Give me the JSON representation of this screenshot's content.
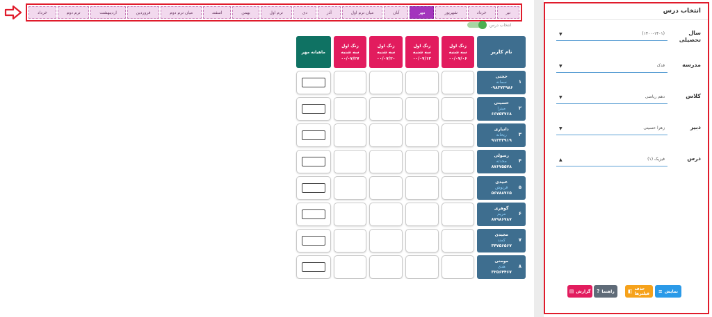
{
  "tabs": [
    {
      "label": "تیر"
    },
    {
      "label": "خرداد"
    },
    {
      "label": "شهریور"
    },
    {
      "label": "مهر",
      "active": true
    },
    {
      "label": "آبان"
    },
    {
      "label": "میان ترم اول"
    },
    {
      "label": "آذر"
    },
    {
      "label": "دی"
    },
    {
      "label": "ترم اول"
    },
    {
      "label": "بهمن"
    },
    {
      "label": "اسفند"
    },
    {
      "label": "میان ترم دوم"
    },
    {
      "label": "فروردین"
    },
    {
      "label": "اردیبهشت"
    },
    {
      "label": "ترم دوم"
    },
    {
      "label": "خرداد"
    }
  ],
  "toggle": {
    "label": "انتخاب درس",
    "on": true
  },
  "grid": {
    "header_name": "نام کاربر",
    "sessions": [
      {
        "line1": "زنگ اول",
        "line2": "سه شنبه",
        "line3": "۰۰/۰۷/۰۶"
      },
      {
        "line1": "زنگ اول",
        "line2": "سه شنبه",
        "line3": "۰۰/۰۷/۱۳"
      },
      {
        "line1": "زنگ اول",
        "line2": "سه شنبه",
        "line3": "۰۰/۰۷/۲۰"
      },
      {
        "line1": "زنگ اول",
        "line2": "سه شنبه",
        "line3": "۰۰/۰۷/۲۷"
      }
    ],
    "header_monthly": "ماهیانه مهر",
    "students": [
      {
        "num": "۱",
        "last": "حجتی",
        "first": "سمانه",
        "phone": "۰۹۸۳۷۳۹۸۶"
      },
      {
        "num": "۲",
        "last": "حسینی",
        "first": "میترا",
        "phone": "۶۶۷۵۳۷۶۸"
      },
      {
        "num": "۳",
        "last": "دانیاری",
        "first": "ریحانه",
        "phone": "۹۱۳۳۳۹۱۹"
      },
      {
        "num": "۴",
        "last": "رسولی",
        "first": "محدثه",
        "phone": "۸۷۶۷۵۵۷۸"
      },
      {
        "num": "۵",
        "last": "عبیدی",
        "first": "فرنوش",
        "phone": "۵۶۷۸۸۷۶۵"
      },
      {
        "num": "۶",
        "last": "گوهری",
        "first": "مریم",
        "phone": "۸۷۹۸۶۷۸۷"
      },
      {
        "num": "۷",
        "last": "مجیدی",
        "first": "کمند",
        "phone": "۳۴۷۵۶۵۶۷"
      },
      {
        "num": "۸",
        "last": "مومنی",
        "first": "هدی",
        "phone": "۳۲۵۶۴۴۶۷"
      }
    ]
  },
  "panel": {
    "title": "انتخاب درس",
    "fields": [
      {
        "label": "سال تحصیلی",
        "value": "(۱۴۰۰-۱۴۰۱)",
        "caret": "▼"
      },
      {
        "label": "مدرسه",
        "value": "فدک",
        "caret": "▼"
      },
      {
        "label": "کلاس",
        "value": "دهم ریاضی",
        "caret": "▼"
      },
      {
        "label": "دبیر",
        "value": "زهرا حسینی",
        "caret": "▼"
      },
      {
        "label": "درس",
        "value": "فیزیک (۱)",
        "caret": "▲"
      }
    ],
    "buttons": {
      "show": "نمایش",
      "filter": "حذف فیلترها",
      "help": "راهنما",
      "report": "گزارش"
    }
  },
  "colors": {
    "accent_red": "#e01b2b",
    "tab_active": "#a335bd",
    "name_header": "#3e6e8f",
    "session_header": "#e21c5e",
    "monthly_header": "#0f7263"
  }
}
